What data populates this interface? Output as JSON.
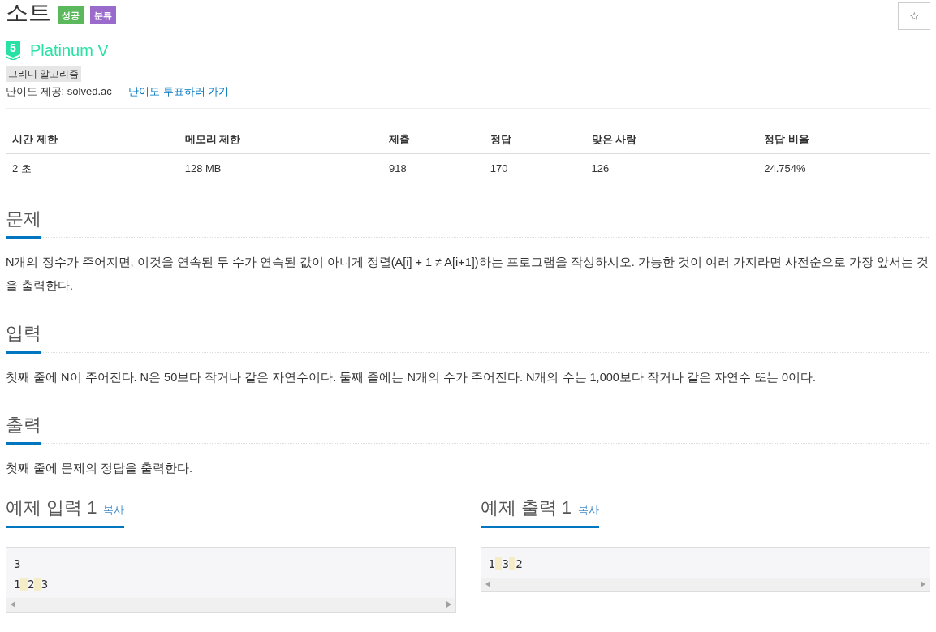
{
  "title": "소트",
  "labels": [
    {
      "text": "성공",
      "color": "#5cb85c"
    },
    {
      "text": "분류",
      "color": "#9b6bcc"
    }
  ],
  "star_button": "☆",
  "tier": {
    "number": "5",
    "name": "Platinum V"
  },
  "tags": [
    "그리디 알고리즘"
  ],
  "difficulty_note": {
    "text": "난이도 제공: solved.ac — ",
    "link": "난이도 투표하러 가기"
  },
  "table": {
    "columns": [
      "시간 제한",
      "메모리 제한",
      "제출",
      "정답",
      "맞은 사람",
      "정답 비율"
    ],
    "rows": [
      [
        "2 초",
        "128 MB",
        "918",
        "170",
        "126",
        "24.754%"
      ]
    ]
  },
  "sections": [
    {
      "heading": "문제",
      "body": "N개의 정수가 주어지면, 이것을 연속된 두 수가 연속된 값이 아니게 정렬(A[i] + 1 ≠ A[i+1])하는 프로그램을 작성하시오. 가능한 것이 여러 가지라면 사전순으로 가장 앞서는 것을 출력한다."
    },
    {
      "heading": "입력",
      "body": "첫째 줄에 N이 주어진다. N은 50보다 작거나 같은 자연수이다. 둘째 줄에는 N개의 수가 주어진다. N개의 수는 1,000보다 작거나 같은 자연수 또는 0이다."
    },
    {
      "heading": "출력",
      "body": "첫째 줄에 문제의 정답을 출력한다."
    }
  ],
  "samples": [
    {
      "heading": "예제 입력 1",
      "copy": "복사",
      "lines": [
        "3",
        "1 2 3"
      ]
    },
    {
      "heading": "예제 출력 1",
      "copy": "복사",
      "lines": [
        "1 3 2"
      ]
    }
  ]
}
